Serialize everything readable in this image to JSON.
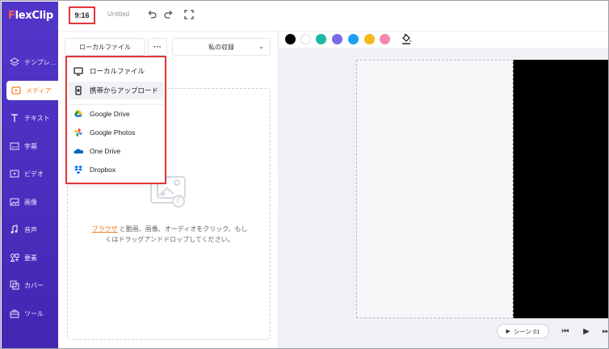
{
  "app": {
    "logo": "FlexClip"
  },
  "topbar": {
    "ratio": "9:16",
    "title": "Untitled"
  },
  "sidebar": {
    "items": [
      {
        "label": "テンプレ…",
        "icon": "layers-icon"
      },
      {
        "label": "メディア",
        "icon": "media-folder-icon",
        "active": true
      },
      {
        "label": "テキスト",
        "icon": "text-icon"
      },
      {
        "label": "字幕",
        "icon": "subtitle-icon"
      },
      {
        "label": "ビデオ",
        "icon": "video-icon"
      },
      {
        "label": "画像",
        "icon": "image-icon"
      },
      {
        "label": "音声",
        "icon": "music-icon"
      },
      {
        "label": "要素",
        "icon": "elements-icon"
      },
      {
        "label": "カバー",
        "icon": "cover-icon"
      },
      {
        "label": "ツール",
        "icon": "toolbox-icon"
      }
    ]
  },
  "panel": {
    "source_select": "ローカルファイル",
    "more": "···",
    "library_select": "私の収録",
    "dropzone": {
      "link": "ブラウザ",
      "text": "と動画、画像、オーディオをクリック、もしくはドラッグアンドドロップしてください。"
    }
  },
  "dropdown": {
    "items": [
      {
        "label": "ローカルファイル",
        "icon": "monitor-icon"
      },
      {
        "label": "携帯からアップロード",
        "icon": "phone-icon"
      },
      {
        "label": "Google Drive",
        "icon": "google-drive-icon"
      },
      {
        "label": "Google Photos",
        "icon": "google-photos-icon"
      },
      {
        "label": "One Drive",
        "icon": "onedrive-icon"
      },
      {
        "label": "Dropbox",
        "icon": "dropbox-icon"
      }
    ]
  },
  "colors": {
    "swatches": [
      "#000000",
      "#ffffff",
      "#1fb8a6",
      "#7a6be6",
      "#1e9ff2",
      "#f7b81b",
      "#f588b0"
    ],
    "brand": "#4a2fbd",
    "accent": "#f07d2a"
  },
  "playback": {
    "scene_label": "シーン 01"
  }
}
